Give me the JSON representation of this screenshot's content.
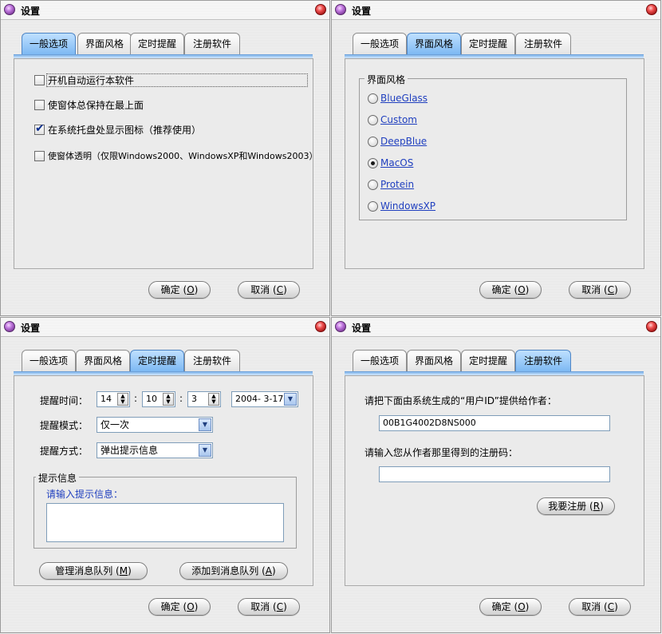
{
  "common": {
    "title": "设置",
    "tabs": [
      "一般选项",
      "界面风格",
      "定时提醒",
      "注册软件"
    ],
    "ok_label": "确定",
    "ok_key": "O",
    "cancel_label": "取消",
    "cancel_key": "C"
  },
  "general": {
    "active_tab": 0,
    "options": [
      {
        "label": "开机自动运行本软件",
        "checked": false
      },
      {
        "label": "使窗体总保持在最上面",
        "checked": false
      },
      {
        "label": "在系统托盘处显示图标（推荐使用）",
        "checked": true
      },
      {
        "label": "使窗体透明（仅限Windows2000、WindowsXP和Windows2003）",
        "checked": false
      }
    ]
  },
  "style": {
    "active_tab": 1,
    "group_title": "界面风格",
    "skins": [
      {
        "label": "BlueGlass",
        "selected": false
      },
      {
        "label": "Custom",
        "selected": false
      },
      {
        "label": "DeepBlue",
        "selected": false
      },
      {
        "label": "MacOS",
        "selected": true
      },
      {
        "label": "Protein",
        "selected": false
      },
      {
        "label": "WindowsXP",
        "selected": false
      }
    ]
  },
  "reminder": {
    "active_tab": 2,
    "time_label": "提醒时间：",
    "hour": "14",
    "minute": "10",
    "second": "3",
    "colon": ":",
    "date": "2004- 3-17",
    "mode_label": "提醒模式：",
    "mode_value": "仅一次",
    "method_label": "提醒方式：",
    "method_value": "弹出提示信息",
    "group_title": "提示信息",
    "prompt_label": "请输入提示信息：",
    "manage_label": "管理消息队列",
    "manage_key": "M",
    "add_label": "添加到消息队列",
    "add_key": "A"
  },
  "register": {
    "active_tab": 3,
    "id_label": "请把下面由系统生成的“用户ID”提供给作者：",
    "user_id": "00B1G4002D8NS000",
    "code_label": "请输入您从作者那里得到的注册码：",
    "code_value": "",
    "register_label": "我要注册",
    "register_key": "R"
  }
}
